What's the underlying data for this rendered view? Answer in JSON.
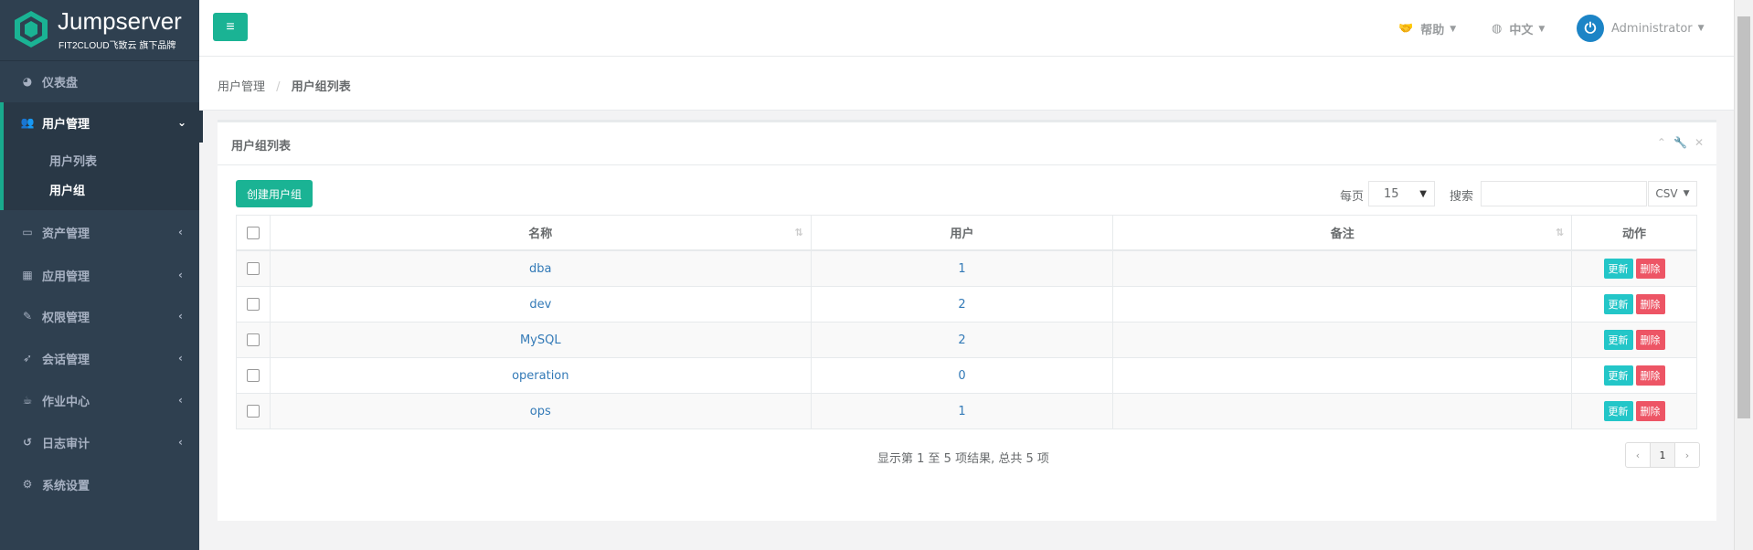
{
  "sidebar": {
    "brand": "Jumpserver",
    "brand_sub": "FIT2CLOUD飞致云 旗下品牌",
    "items": [
      {
        "label": "仪表盘",
        "icon": "dashboard-icon"
      },
      {
        "label": "用户管理",
        "icon": "users-icon",
        "active": true
      },
      {
        "label": "资产管理",
        "icon": "laptop-icon"
      },
      {
        "label": "应用管理",
        "icon": "grid-icon"
      },
      {
        "label": "权限管理",
        "icon": "edit-icon"
      },
      {
        "label": "会话管理",
        "icon": "rocket-icon"
      },
      {
        "label": "作业中心",
        "icon": "coffee-icon"
      },
      {
        "label": "日志审计",
        "icon": "history-icon"
      },
      {
        "label": "系统设置",
        "icon": "gears-icon"
      }
    ],
    "subitems": [
      {
        "label": "用户列表"
      },
      {
        "label": "用户组",
        "active": true
      }
    ]
  },
  "topbar": {
    "help": "帮助",
    "language": "中文",
    "user": "Administrator"
  },
  "breadcrumb": {
    "parent": "用户管理",
    "current": "用户组列表"
  },
  "panel": {
    "title": "用户组列表",
    "create_button": "创建用户组",
    "per_page_label": "每页",
    "per_page_value": "15",
    "search_label": "搜索",
    "search_value": "",
    "export": "CSV"
  },
  "table": {
    "columns": [
      "名称",
      "用户",
      "备注",
      "动作"
    ],
    "rows": [
      {
        "name": "dba",
        "users": "1",
        "comment": ""
      },
      {
        "name": "dev",
        "users": "2",
        "comment": ""
      },
      {
        "name": "MySQL",
        "users": "2",
        "comment": ""
      },
      {
        "name": "operation",
        "users": "0",
        "comment": ""
      },
      {
        "name": "ops",
        "users": "1",
        "comment": ""
      }
    ],
    "update_label": "更新",
    "delete_label": "删除"
  },
  "footer": {
    "info": "显示第 1 至 5 项结果, 总共 5 项",
    "page": "1",
    "prev": "‹",
    "next": "›"
  },
  "colors": {
    "sidebar_bg": "#2f4050",
    "primary": "#1ab394",
    "info": "#23c6c8",
    "danger": "#ed5565",
    "link": "#337ab7"
  }
}
